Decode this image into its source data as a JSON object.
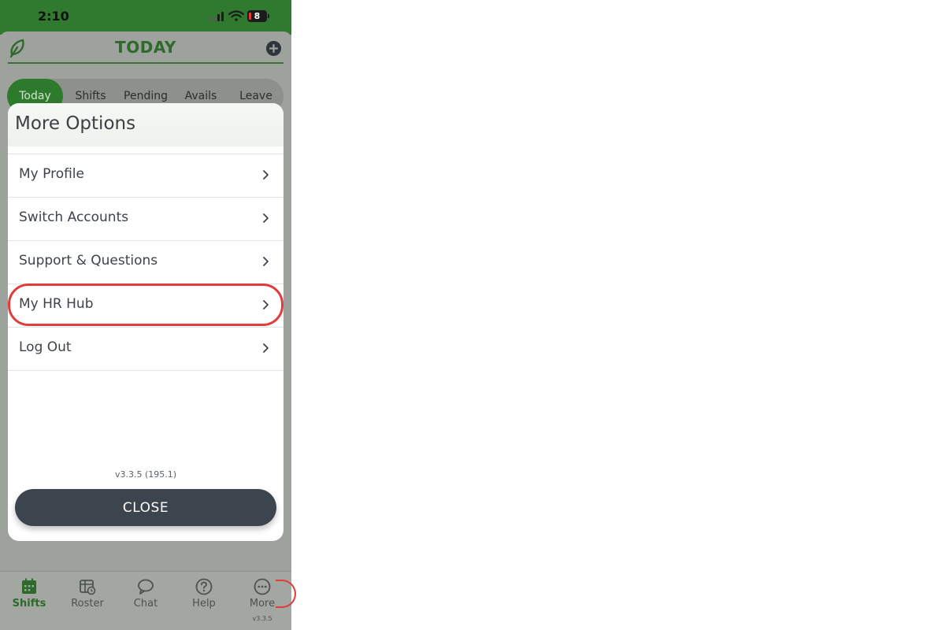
{
  "status_bar": {
    "time": "2:10",
    "battery": "8"
  },
  "header": {
    "title": "TODAY"
  },
  "tabs": [
    {
      "label": "Today",
      "active": true
    },
    {
      "label": "Shifts",
      "active": false
    },
    {
      "label": "Pending",
      "active": false
    },
    {
      "label": "Avails",
      "active": false
    },
    {
      "label": "Leave",
      "active": false
    }
  ],
  "modal": {
    "title": "More Options",
    "options": [
      {
        "label": "My Profile"
      },
      {
        "label": "Switch Accounts"
      },
      {
        "label": "Support & Questions"
      },
      {
        "label": "My HR Hub",
        "highlighted": true
      },
      {
        "label": "Log Out"
      }
    ],
    "version": "v3.3.5 (195.1)",
    "close_label": "CLOSE"
  },
  "bottom_nav": {
    "items": [
      {
        "label": "Shifts",
        "icon": "calendar-icon",
        "active": true
      },
      {
        "label": "Roster",
        "icon": "roster-icon",
        "active": false
      },
      {
        "label": "Chat",
        "icon": "chat-bubble-icon",
        "active": false
      },
      {
        "label": "Help",
        "icon": "help-circle-icon",
        "active": false
      },
      {
        "label": "More",
        "icon": "more-dots-icon",
        "active": false
      }
    ],
    "version": "v3.3.5"
  },
  "colors": {
    "brand_green": "#2e7a2d",
    "highlight_red": "#e23b3b",
    "button_dark": "#3c454e"
  }
}
